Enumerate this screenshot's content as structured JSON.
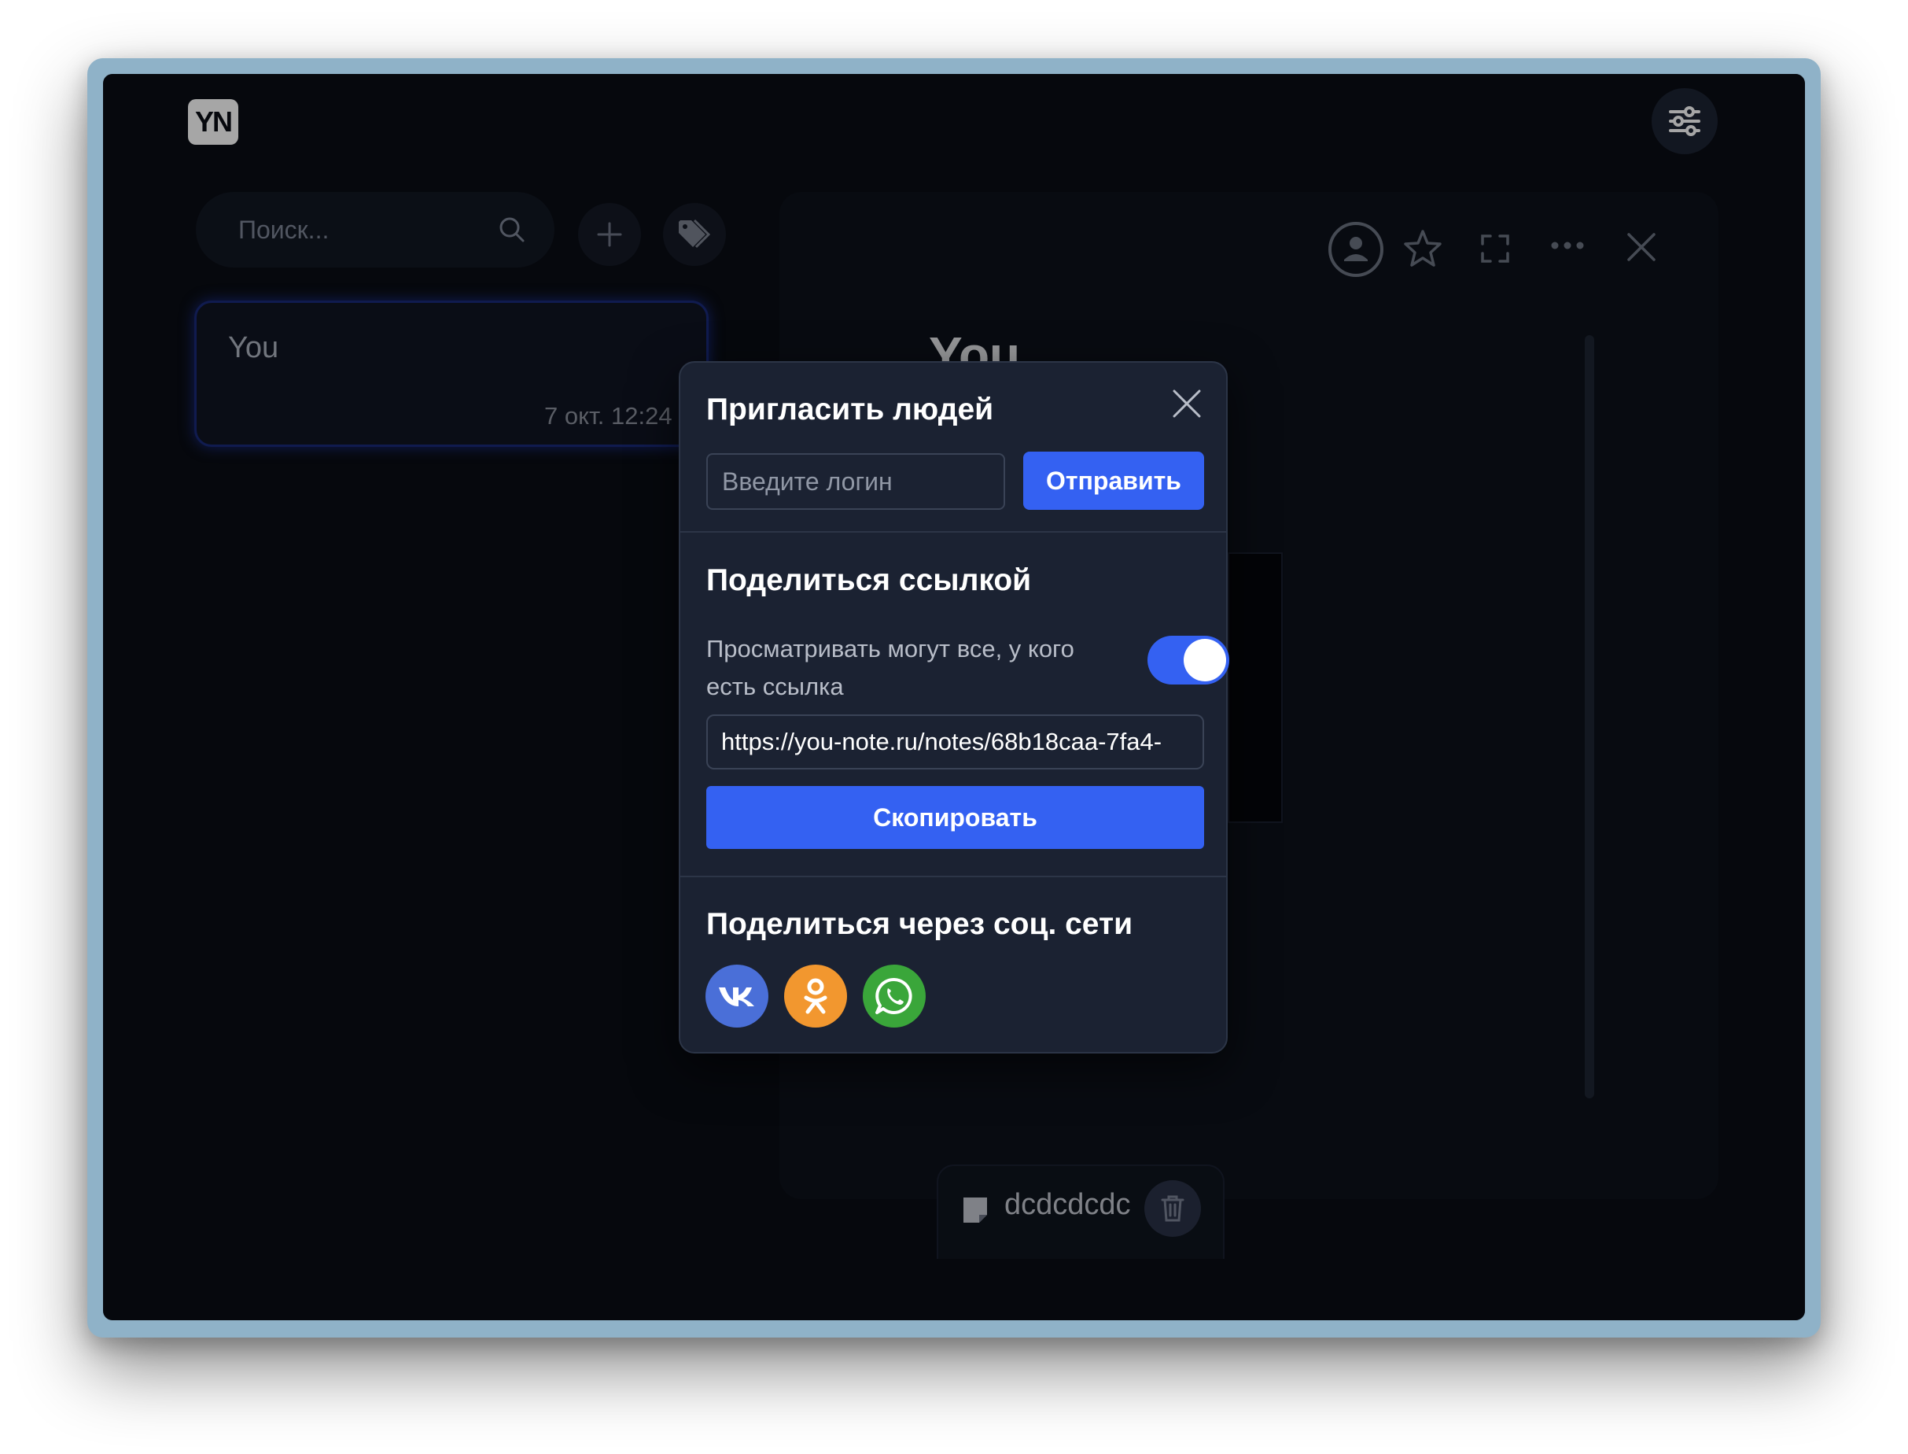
{
  "app": {
    "logo_text": "YN"
  },
  "search": {
    "placeholder": "Поиск..."
  },
  "notes": [
    {
      "title": "You",
      "date": "7 окт. 12:24"
    }
  ],
  "note_view": {
    "heading": "You",
    "attachment_name": "dcdcdcdc"
  },
  "share_modal": {
    "invite_title": "Пригласить людей",
    "login_placeholder": "Введите логин",
    "send_label": "Отправить",
    "link_title": "Поделиться ссылкой",
    "toggle_label": "Просматривать могут все, у кого есть ссылка",
    "toggle_on": true,
    "share_url": "https://you-note.ru/notes/68b18caa-7fa4-",
    "copy_label": "Скопировать",
    "social_title": "Поделиться через соц. сети",
    "social": [
      {
        "name": "vk",
        "color": "#4a6fd8"
      },
      {
        "name": "odnoklassniki",
        "color": "#f2972f"
      },
      {
        "name": "whatsapp",
        "color": "#3aa63a"
      }
    ]
  },
  "colors": {
    "accent": "#3461f2",
    "background": "#0a0d14",
    "modal_bg": "#1b2232"
  }
}
